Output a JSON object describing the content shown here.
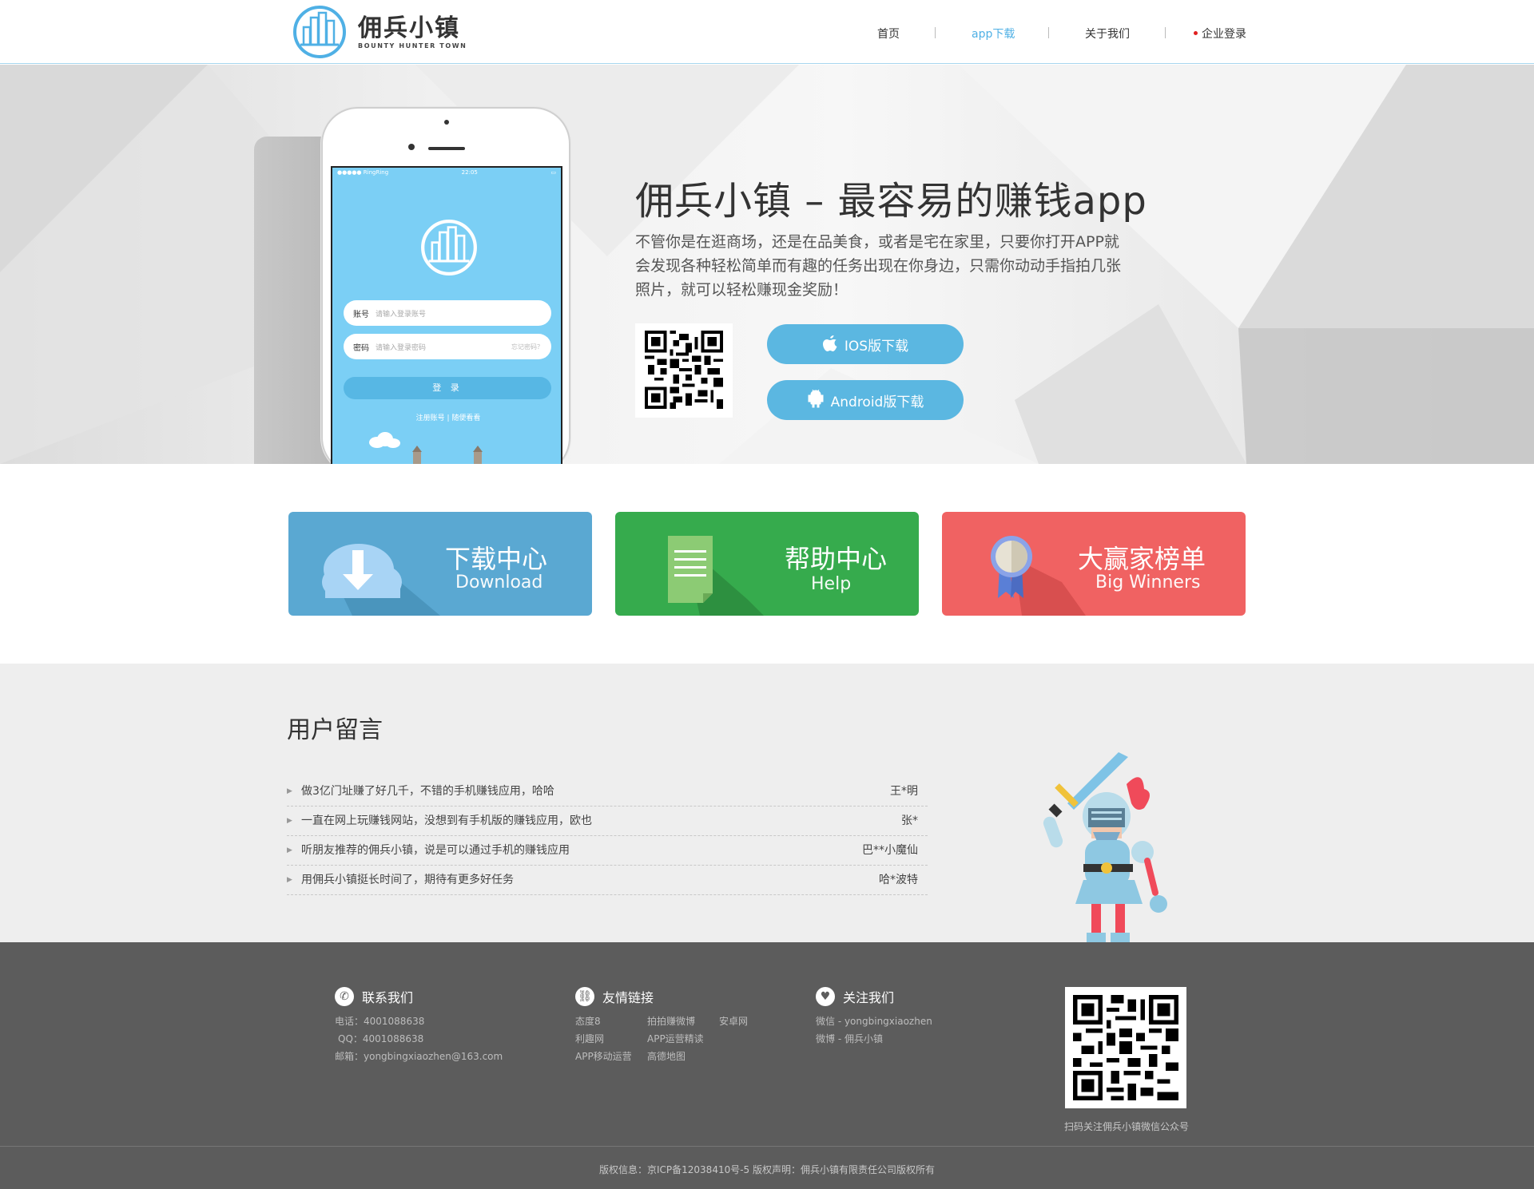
{
  "header": {
    "logo_cn": "佣兵小镇",
    "logo_en": "BOUNTY HUNTER TOWN",
    "nav": [
      "首页",
      "app下载",
      "关于我们",
      "企业登录"
    ]
  },
  "banner": {
    "title": "佣兵小镇 – 最容易的赚钱app",
    "desc": "不管你是在逛商场，还是在品美食，或者是宅在家里，只要你打开APP就会发现各种轻松简单而有趣的任务出现在你身边，只需你动动手指拍几张照片，就可以轻松赚现金奖励！",
    "ios_btn": "IOS版下载",
    "android_btn": "Android版下载",
    "phone": {
      "carrier": "●●●●● RingRing",
      "time": "22:05",
      "account_label": "账号",
      "account_placeholder": "请输入登录账号",
      "password_label": "密码",
      "password_placeholder": "请输入登录密码",
      "forgot": "忘记密码？",
      "login_btn": "登 录",
      "links": "注册账号 | 随便看看"
    }
  },
  "cards": [
    {
      "title": "下载中心",
      "sub": "Download",
      "color": "#5aa8d2"
    },
    {
      "title": "帮助中心",
      "sub": "Help",
      "color": "#36ab4d"
    },
    {
      "title": "大赢家榜单",
      "sub": "Big Winners",
      "color": "#f06262"
    }
  ],
  "messages": {
    "title": "用户留言",
    "items": [
      {
        "text": "做3亿门址赚了好几千，不错的手机赚钱应用，哈哈",
        "who": "王*明"
      },
      {
        "text": "一直在网上玩赚钱网站，没想到有手机版的赚钱应用，欧也",
        "who": "张*"
      },
      {
        "text": "听朋友推荐的佣兵小镇，说是可以通过手机的赚钱应用",
        "who": "巴**小魔仙"
      },
      {
        "text": "用佣兵小镇挺长时间了，期待有更多好任务",
        "who": "哈*波特"
      }
    ]
  },
  "footer": {
    "contact": {
      "title": "联系我们",
      "lines": [
        "电话：4001088638",
        " QQ：4001088638",
        "邮箱：yongbingxiaozhen@163.com"
      ]
    },
    "links": {
      "title": "友情链接",
      "items": [
        "态度8",
        "拍拍赚微博",
        "安卓网",
        "利趣网",
        "APP运营精读",
        "",
        "APP移动运营",
        "高德地图",
        ""
      ]
    },
    "follow": {
      "title": "关注我们",
      "lines": [
        "微信 - yongbingxiaozhen",
        "微博 - 佣兵小镇"
      ]
    },
    "qr_caption": "扫码关注佣兵小镇微信公众号",
    "copyright": "版权信息：京ICP备12038410号-5  版权声明：佣兵小镇有限责任公司版权所有"
  }
}
